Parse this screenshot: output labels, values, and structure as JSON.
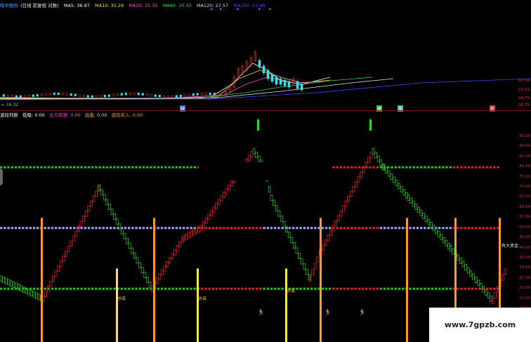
{
  "top": {
    "stock_name": "昭中股份",
    "mode": "(日线 前复权 对数)",
    "ma": [
      {
        "label": "MA5: 36.97",
        "color": "#ffffff"
      },
      {
        "label": "MA10: 35.28",
        "color": "#ffd54a"
      },
      {
        "label": "MA20: 35.35",
        "color": "#ff4fd8"
      },
      {
        "label": "MA60: 35.43",
        "color": "#34d058"
      },
      {
        "label": "MA120: 27.57",
        "color": "#e0e0e0"
      },
      {
        "label": "MA250: 23.98",
        "color": "#3a4bff"
      }
    ],
    "low_price": "← 16.32",
    "price_axis": [
      "42.18",
      "22.51",
      "19.79",
      "16.75"
    ],
    "markers": [
      {
        "text": "财",
        "color": "#3a7bd5"
      },
      {
        "text": "周",
        "color": "#2fb84a"
      },
      {
        "text": "涨",
        "color": "#2fb8a8"
      },
      {
        "text": "跌",
        "color": "#c83030"
      }
    ]
  },
  "indicator": {
    "name": "波段判断",
    "fields": [
      {
        "label": "低吸: 0.00",
        "color": "#ffffff"
      },
      {
        "label": "主力买进: 0.00",
        "color": "#ff4fd8"
      },
      {
        "label": "出击: 0.00",
        "color": "#ffd54a"
      },
      {
        "label": "波段买入: 0.00",
        "color": "#ff9a3a"
      }
    ],
    "axis": [
      "95.00",
      "90.00",
      "85.00",
      "80.00",
      "75.00",
      "70.00",
      "65.00",
      "60.00",
      "55.00",
      "50.00",
      "45.00",
      "40.00",
      "35.00",
      "30.00",
      "25.00",
      "20.00",
      "15.00",
      "10.00"
    ],
    "bottom_labels": [
      "抄底",
      "抄底",
      "抄底"
    ],
    "right_label": "有大资金",
    "levels": {
      "upper": 80,
      "middle": 50,
      "lower": 20
    },
    "colors": {
      "up_bar": "#d42020",
      "down_bar": "#22b022",
      "level_red": "#e02020",
      "level_green": "#22c022",
      "middle_blue": "#a0a0ff",
      "orange_line": "#ff9a2a",
      "yellow_line": "#ffe45a",
      "signal_green": "#22dd22"
    }
  },
  "watermark": "www.7gpzb.com"
}
